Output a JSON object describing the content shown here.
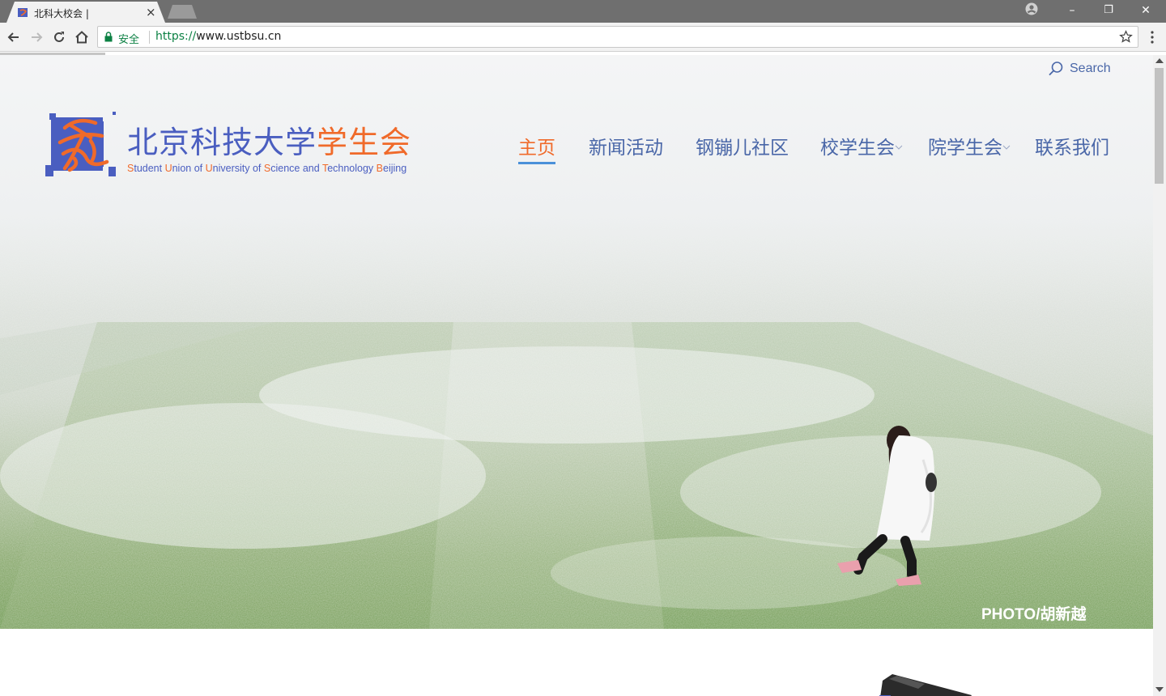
{
  "browser": {
    "tab_title": "北科大校会 |",
    "tab_close": "×",
    "secure_label": "安全",
    "url_scheme": "https://",
    "url_host": "www.ustbsu.cn",
    "window_minimize": "–",
    "window_restore": "❐",
    "window_close": "✕"
  },
  "site": {
    "search_label": "Search",
    "logo": {
      "title_blue": "北京科技大学",
      "title_orange": "学生会",
      "subtitle_parts": [
        {
          "t": "S",
          "o": true
        },
        {
          "t": "tudent ",
          "o": false
        },
        {
          "t": "U",
          "o": true
        },
        {
          "t": "nion of ",
          "o": false
        },
        {
          "t": "U",
          "o": true
        },
        {
          "t": "niversity of ",
          "o": false
        },
        {
          "t": "S",
          "o": true
        },
        {
          "t": "cience and ",
          "o": false
        },
        {
          "t": "T",
          "o": true
        },
        {
          "t": "echnology ",
          "o": false
        },
        {
          "t": "B",
          "o": true
        },
        {
          "t": "eijing",
          "o": false
        }
      ]
    },
    "nav": [
      {
        "label": "主页",
        "active": true
      },
      {
        "label": "新闻活动",
        "active": false
      },
      {
        "label": "钢镚儿社区",
        "active": false
      },
      {
        "label": "校学生会",
        "active": false,
        "dropdown": true
      },
      {
        "label": "院学生会",
        "active": false,
        "dropdown": true
      },
      {
        "label": "联系我们",
        "active": false
      }
    ],
    "photo_credit": "PHOTO/胡新越"
  },
  "colors": {
    "brand_blue": "#4a5ec0",
    "brand_orange": "#f06a2a",
    "nav_blue": "#4a67a8",
    "nav_underline": "#4a90d9",
    "secure_green": "#0b8043"
  }
}
